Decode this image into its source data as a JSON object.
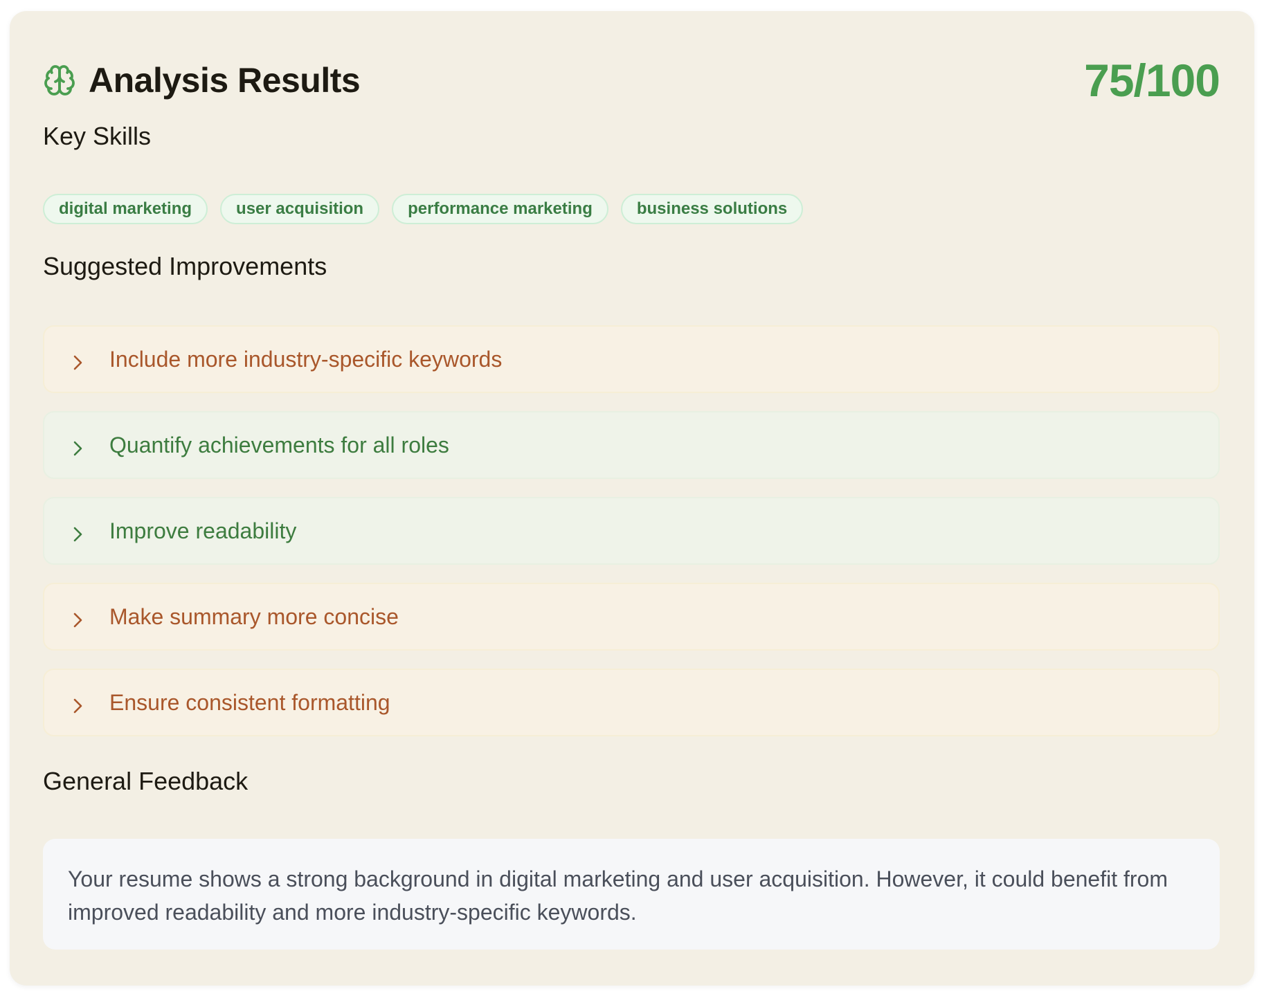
{
  "header": {
    "title": "Analysis Results",
    "score": "75/100",
    "icon": "brain-icon"
  },
  "skills": {
    "heading": "Key Skills",
    "items": [
      "digital marketing",
      "user acquisition",
      "performance marketing",
      "business solutions"
    ]
  },
  "improvements": {
    "heading": "Suggested Improvements",
    "items": [
      {
        "label": "Include more industry-specific keywords",
        "tone": "warn"
      },
      {
        "label": "Quantify achievements for all roles",
        "tone": "good"
      },
      {
        "label": "Improve readability",
        "tone": "good"
      },
      {
        "label": "Make summary more concise",
        "tone": "warn"
      },
      {
        "label": "Ensure consistent formatting",
        "tone": "warn"
      }
    ]
  },
  "feedback": {
    "heading": "General Feedback",
    "text": "Your resume shows a strong background in digital marketing and user acquisition. However, it could benefit from improved readability and more industry-specific keywords."
  },
  "colors": {
    "accent": "#4a9e50",
    "warn_text": "#a9572b",
    "good_text": "#3d7c3f",
    "card_bg": "#f3efe4"
  }
}
